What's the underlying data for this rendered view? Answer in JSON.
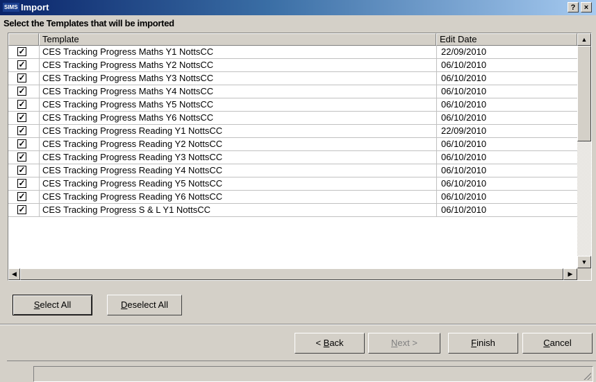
{
  "window": {
    "logo": "SIMS",
    "title": "Import",
    "help_label": "?",
    "close_label": "×"
  },
  "instruction": "Select the Templates that will be imported",
  "grid": {
    "columns": {
      "template": "Template",
      "edit_date": "Edit Date"
    },
    "rows": [
      {
        "checked": true,
        "template": "CES Tracking Progress Maths Y1 NottsCC",
        "edit_date": "22/09/2010"
      },
      {
        "checked": true,
        "template": "CES Tracking Progress Maths Y2 NottsCC",
        "edit_date": "06/10/2010"
      },
      {
        "checked": true,
        "template": "CES Tracking Progress Maths Y3 NottsCC",
        "edit_date": "06/10/2010"
      },
      {
        "checked": true,
        "template": "CES Tracking Progress Maths Y4 NottsCC",
        "edit_date": "06/10/2010"
      },
      {
        "checked": true,
        "template": "CES Tracking Progress Maths Y5 NottsCC",
        "edit_date": "06/10/2010"
      },
      {
        "checked": true,
        "template": "CES Tracking Progress Maths Y6 NottsCC",
        "edit_date": "06/10/2010"
      },
      {
        "checked": true,
        "template": "CES Tracking Progress Reading Y1 NottsCC",
        "edit_date": "22/09/2010"
      },
      {
        "checked": true,
        "template": "CES Tracking Progress Reading Y2 NottsCC",
        "edit_date": "06/10/2010"
      },
      {
        "checked": true,
        "template": "CES Tracking Progress Reading Y3 NottsCC",
        "edit_date": "06/10/2010"
      },
      {
        "checked": true,
        "template": "CES Tracking Progress Reading Y4 NottsCC",
        "edit_date": "06/10/2010"
      },
      {
        "checked": true,
        "template": "CES Tracking Progress Reading Y5 NottsCC",
        "edit_date": "06/10/2010"
      },
      {
        "checked": true,
        "template": "CES Tracking Progress Reading Y6 NottsCC",
        "edit_date": "06/10/2010"
      },
      {
        "checked": true,
        "template": "CES Tracking Progress S & L Y1 NottsCC",
        "edit_date": "06/10/2010"
      }
    ]
  },
  "buttons": {
    "select_all": {
      "prefix": "",
      "key": "S",
      "rest": "elect All"
    },
    "deselect_all": {
      "prefix": "",
      "key": "D",
      "rest": "eselect All"
    },
    "back": {
      "prefix": "< ",
      "key": "B",
      "rest": "ack"
    },
    "next": {
      "prefix": "",
      "key": "N",
      "rest": "ext >"
    },
    "finish": {
      "prefix": "",
      "key": "F",
      "rest": "inish"
    },
    "cancel": {
      "prefix": "",
      "key": "C",
      "rest": "ancel"
    }
  },
  "icons": {
    "check": "✓",
    "scroll_up": "▲",
    "scroll_down": "▼",
    "scroll_left": "◀",
    "scroll_right": "▶"
  },
  "colors": {
    "titlebar_start": "#0a246a",
    "titlebar_end": "#a6caf0",
    "face": "#d4d0c8"
  }
}
